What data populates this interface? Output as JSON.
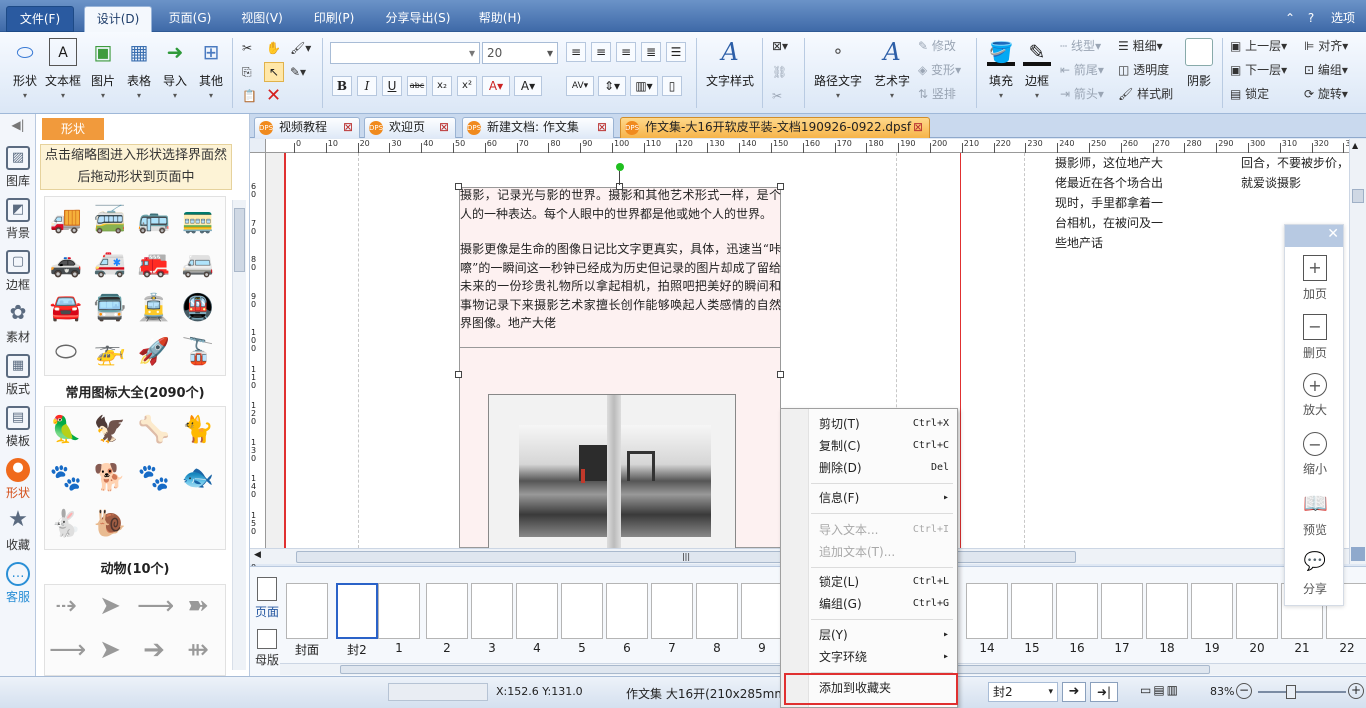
{
  "menubar": {
    "file": "文件(F)",
    "tabs": [
      "设计(D)",
      "页面(G)",
      "视图(V)",
      "印刷(P)",
      "分享导出(S)",
      "帮助(H)"
    ],
    "options": "选项"
  },
  "ribbon": {
    "insert": [
      "形状",
      "文本框",
      "图片",
      "表格",
      "导入",
      "其他"
    ],
    "font_size": "20",
    "text_style": "文字样式",
    "path_text": "路径文字",
    "art_text": "艺术字",
    "art_small": [
      "修改",
      "变形",
      "竖排"
    ],
    "fill": "填充",
    "border": "边框",
    "line_small": [
      "线型",
      "箭尾",
      "箭头"
    ],
    "weight_small": [
      "粗细",
      "透明度",
      "样式刷"
    ],
    "shadow": "阴影",
    "layer_small": [
      "上一层",
      "下一层",
      "锁定"
    ],
    "arrange_small": [
      "对齐",
      "编组",
      "旋转"
    ]
  },
  "leftbar": [
    "图库",
    "背景",
    "边框",
    "素材",
    "版式",
    "模板",
    "形状",
    "收藏",
    "客服"
  ],
  "panel": {
    "tab": "形状",
    "hint": "点击缩略图进入形状选择界面然后拖动形状到页面中",
    "group1": "常用图标大全(2090个)",
    "group2": "动物(10个)"
  },
  "doc_tabs": [
    {
      "label": "视频教程"
    },
    {
      "label": "欢迎页"
    },
    {
      "label": "新建文档: 作文集"
    },
    {
      "label": "作文集-大16开软皮平装-文档190926-0922.dpsf"
    }
  ],
  "ruler": {
    "top": [
      "0",
      "10",
      "20",
      "30",
      "40",
      "50",
      "60",
      "70",
      "80",
      "90",
      "100",
      "110",
      "120",
      "130",
      "140",
      "150",
      "160",
      "170",
      "180",
      "190",
      "200",
      "210",
      "220",
      "230",
      "240",
      "250",
      "260",
      "270",
      "280",
      "290",
      "300",
      "310",
      "320",
      "33"
    ],
    "left": [
      "60",
      "70",
      "80",
      "90",
      "100",
      "110",
      "120",
      "130",
      "140",
      "150",
      "160"
    ]
  },
  "document": {
    "para1": "摄影，记录光与影的世界。摄影和其他艺术形式一样，是个人的一种表达。每个人眼中的世界都是他或她个人的世界。",
    "para2": "摄影更像是生命的图像日记比文字更真实，具体，迅速当“咔嚓”的一瞬间这一秒钟已经成为历史但记录的图片却成了留给未来的一份珍贵礼物所以拿起相机，拍照吧把美好的瞬间和事物记录下来摄影艺术家擅长创作能够唤起人类感情的自然界图像。地产大佬",
    "right_col": "摄影师，这位地产大佬最近在各个场合出现时，手里都拿着一台相机，在被问及一些地产话",
    "far_right": "回合，不要被步价，就爱谈摄影"
  },
  "context_menu": [
    {
      "label": "剪切(T)",
      "shortcut": "Ctrl+X"
    },
    {
      "label": "复制(C)",
      "shortcut": "Ctrl+C"
    },
    {
      "label": "删除(D)",
      "shortcut": "Del"
    },
    {
      "label": "信息(F)",
      "shortcut": ""
    },
    {
      "label": "导入文本...",
      "shortcut": "Ctrl+I"
    },
    {
      "label": "追加文本(T)...",
      "shortcut": ""
    },
    {
      "label": "锁定(L)",
      "shortcut": "Ctrl+L"
    },
    {
      "label": "编组(G)",
      "shortcut": "Ctrl+G"
    },
    {
      "label": "层(Y)",
      "shortcut": ""
    },
    {
      "label": "文字环绕",
      "shortcut": ""
    },
    {
      "label": "添加到收藏夹",
      "shortcut": ""
    }
  ],
  "float_toolbar": [
    "加页",
    "删页",
    "放大",
    "缩小",
    "预览",
    "分享"
  ],
  "pages": {
    "page_label": "页面",
    "master_label": "母版",
    "items": [
      "封面",
      "封2",
      "1",
      "2",
      "3",
      "4",
      "5",
      "6",
      "7",
      "8",
      "9",
      "14",
      "15",
      "16",
      "17",
      "18",
      "19",
      "20",
      "21",
      "22"
    ]
  },
  "status": {
    "coords": "X:152.6  Y:131.0",
    "doc_info": "作文集 大16开(210x285mm)",
    "page_select": "封2",
    "zoom": "83%"
  },
  "colors": {
    "accent": "#f19a3c",
    "menu_blue": "#3f6aa8",
    "highlight_red": "#e03030"
  }
}
